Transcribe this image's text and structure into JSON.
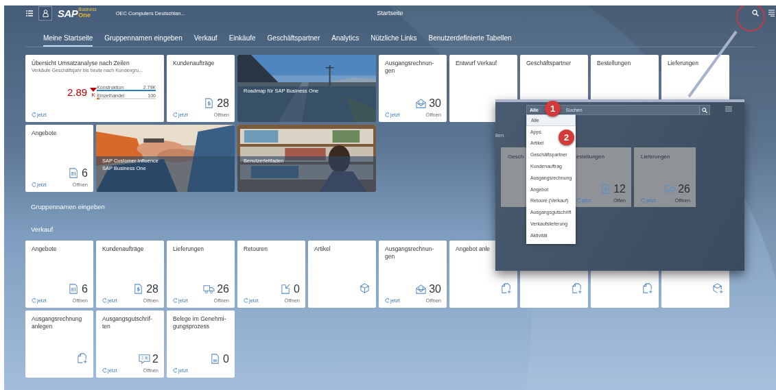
{
  "header": {
    "logo": {
      "main": "SAP",
      "top": "Business",
      "bottom": "One"
    },
    "company": "OEC Computers Deutschlan...",
    "title": "Startseite"
  },
  "tabs": [
    {
      "label": "Meine Startseite",
      "selected": true
    },
    {
      "label": "Gruppennamen eingeben",
      "selected": false
    },
    {
      "label": "Verkauf",
      "selected": false
    },
    {
      "label": "Einkäufe",
      "selected": false
    },
    {
      "label": "Geschäftspartner",
      "selected": false
    },
    {
      "label": "Analytics",
      "selected": false
    },
    {
      "label": "Nützliche Links",
      "selected": false
    },
    {
      "label": "Benutzerdefinierte Tabellen",
      "selected": false
    }
  ],
  "home_tiles": [
    {
      "kind": "analytics",
      "title": "Übersicht Umsatzanalyse nach Zeilen",
      "subtitle": "Verkäufe Geschäftsjahr bis heute nach Kundengru...",
      "value": "2.89",
      "unit": "K",
      "bars": [
        {
          "label": "Konstruktion",
          "reading": "2.79K",
          "level": 1.0,
          "color": "#2f7cc4"
        },
        {
          "label": "Einzelhandel",
          "reading": "100",
          "level": 0.04,
          "color": "#e5661a"
        }
      ],
      "refresh": "jetzt"
    },
    {
      "kind": "kpi",
      "title": "Kundenaufträge",
      "number": "28",
      "refresh": "jetzt",
      "open": "Öffnen"
    },
    {
      "kind": "picture",
      "title": "Roadmap für SAP Business One"
    },
    {
      "kind": "kpi",
      "title": "Ausgangsrechnun-gen",
      "number": "30",
      "refresh": "jetzt",
      "open": "Öffnen"
    },
    {
      "kind": "kpi",
      "title": "Entwurf Verkauf"
    },
    {
      "kind": "kpi",
      "title": "Geschäftspartner"
    },
    {
      "kind": "kpi",
      "title": "Bestellungen"
    },
    {
      "kind": "kpi",
      "title": "Lieferungen"
    },
    {
      "kind": "kpi",
      "title": "Angebote",
      "number": "6",
      "refresh": "jetzt",
      "open": "Öffnen"
    },
    {
      "kind": "picture",
      "title": "SAP Customer Influence",
      "subtitle": "SAP Business One"
    },
    {
      "kind": "picture",
      "title": "Benutzerleitfaden"
    }
  ],
  "groups": [
    {
      "title": "Gruppennamen eingeben"
    },
    {
      "title": "Verkauf"
    }
  ],
  "sales_tiles": [
    {
      "kind": "kpi",
      "title": "Angebote",
      "number": "6",
      "refresh": "jetzt",
      "open": "Öffnen"
    },
    {
      "kind": "kpi",
      "title": "Kundenaufträge",
      "number": "28",
      "refresh": "jetzt",
      "open": "Öffnen"
    },
    {
      "kind": "kpi",
      "title": "Lieferungen",
      "number": "26",
      "refresh": "jetzt",
      "open": "Öffnen"
    },
    {
      "kind": "kpi",
      "title": "Retouren",
      "number": "0",
      "refresh": "jetzt",
      "open": "Öffnen"
    },
    {
      "kind": "launch",
      "title": "Artikel"
    },
    {
      "kind": "kpi",
      "title": "Ausgangsrechnun-gen",
      "number": "30",
      "refresh": "jetzt",
      "open": "Öffnen"
    },
    {
      "kind": "launch",
      "title": "Angebot anle"
    },
    {
      "kind": "launch"
    },
    {
      "kind": "launch"
    },
    {
      "kind": "launch"
    },
    {
      "kind": "launch",
      "title": "Ausgangsrechnung anlegen"
    },
    {
      "kind": "kpi",
      "title": "Ausgangsgutschrif-ten",
      "number": "2",
      "refresh": "jetzt",
      "open": "Öffnen"
    },
    {
      "kind": "kpi",
      "title": "Belege im Genehmi-gungsprozess",
      "number": "0",
      "refresh": "jetzt"
    }
  ],
  "callout": {
    "scope": "Alle",
    "placeholder": "Suchen",
    "section_fragment": "llen",
    "tiles": [
      {
        "title": "Gesch"
      },
      {
        "title": "estellungen",
        "number": "12",
        "refresh": "jetzt",
        "open": "Offen"
      },
      {
        "title": "Lieferungen",
        "number": "26",
        "refresh": "jetzt",
        "open": "Öffnen"
      }
    ],
    "menu": [
      {
        "label": "Alle",
        "selected": true
      },
      {
        "label": "Apps",
        "selected": false
      },
      {
        "label": "Artikel",
        "selected": false
      },
      {
        "label": "Geschäftspartner",
        "selected": false
      },
      {
        "label": "Kundenauftrag",
        "selected": false
      },
      {
        "label": "Ausgangsrechnung",
        "selected": false
      },
      {
        "label": "Angebot",
        "selected": false
      },
      {
        "label": "Retoure (Verkauf)",
        "selected": false
      },
      {
        "label": "Ausgangsgutschrift",
        "selected": false
      },
      {
        "label": "Verkaufslieferung",
        "selected": false
      },
      {
        "label": "Aktivität",
        "selected": false
      }
    ],
    "badges": [
      "1",
      "2"
    ]
  }
}
